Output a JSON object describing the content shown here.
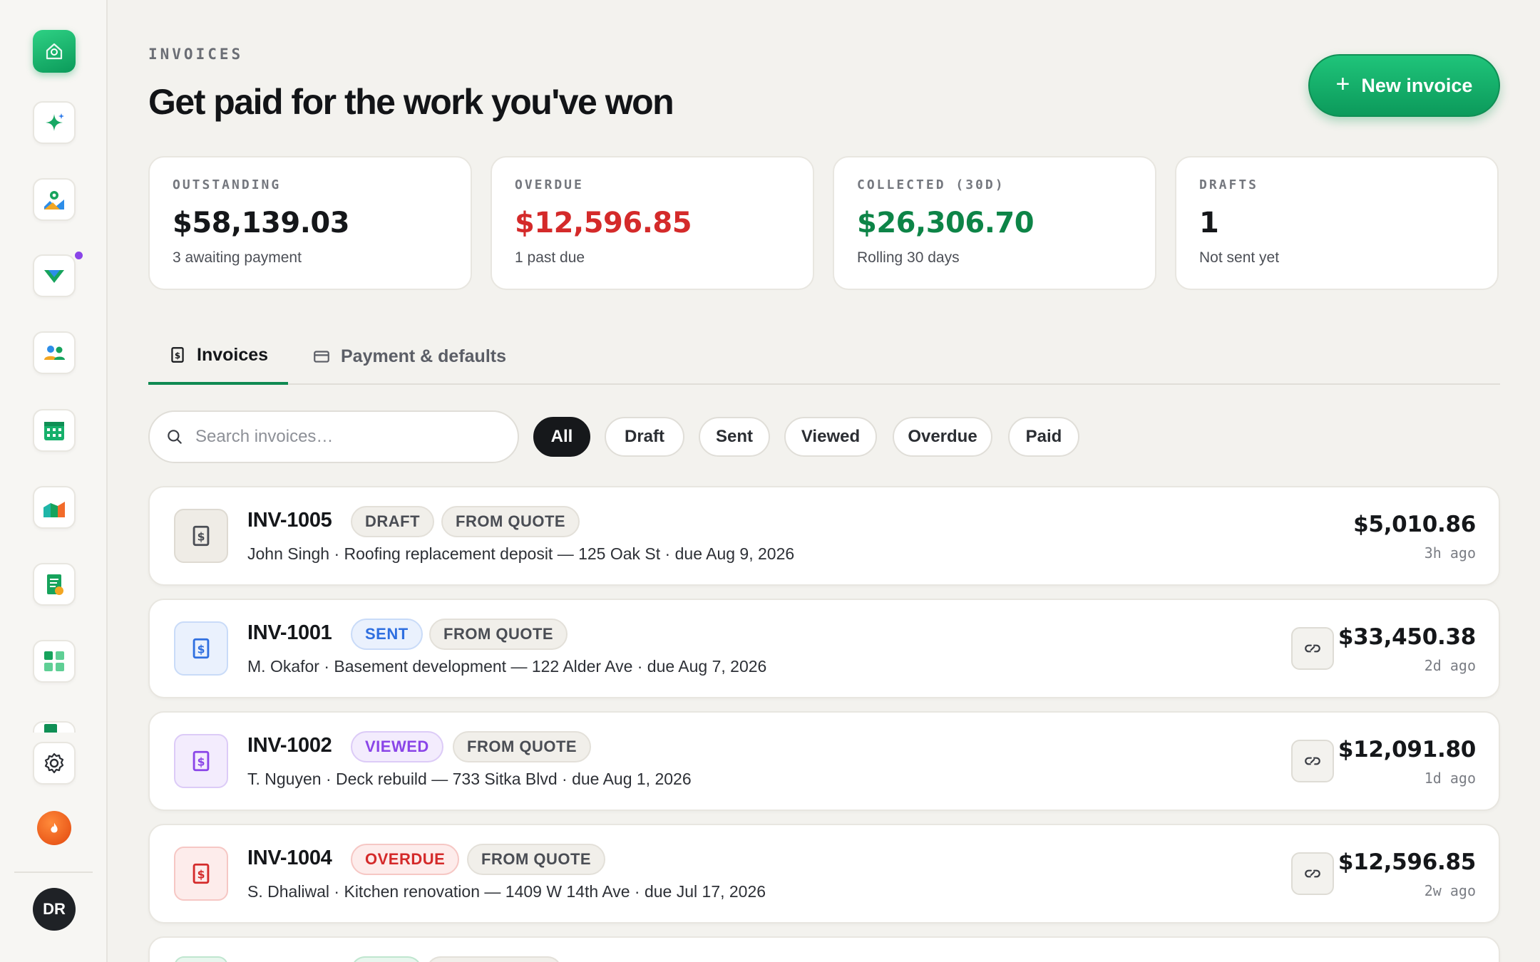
{
  "header": {
    "eyebrow": "INVOICES",
    "title": "Get paid for the work you've won",
    "new_button": "New invoice"
  },
  "stats": [
    {
      "label": "OUTSTANDING",
      "value": "$58,139.03",
      "sub": "3 awaiting payment",
      "color": "#15171a"
    },
    {
      "label": "OVERDUE",
      "value": "$12,596.85",
      "sub": "1 past due",
      "color": "#d42a2a"
    },
    {
      "label": "COLLECTED (30D)",
      "value": "$26,306.70",
      "sub": "Rolling 30 days",
      "color": "#0d8447"
    },
    {
      "label": "DRAFTS",
      "value": "1",
      "sub": "Not sent yet",
      "color": "#15171a"
    }
  ],
  "tabs": [
    {
      "label": "Invoices",
      "active": true
    },
    {
      "label": "Payment & defaults",
      "active": false
    }
  ],
  "search": {
    "placeholder": "Search invoices…",
    "value": ""
  },
  "filters": [
    "All",
    "Draft",
    "Sent",
    "Viewed",
    "Overdue",
    "Paid"
  ],
  "active_filter": "All",
  "invoices": [
    {
      "id": "INV-1005",
      "status": "DRAFT",
      "source": "FROM QUOTE",
      "description": "John Singh · Roofing replacement deposit — 125 Oak St · due Aug 9, 2026",
      "amount": "$5,010.86",
      "time": "3h ago"
    },
    {
      "id": "INV-1001",
      "status": "SENT",
      "source": "FROM QUOTE",
      "description": "M. Okafor · Basement development — 122 Alder Ave · due Aug 7, 2026",
      "amount": "$33,450.38",
      "time": "2d ago"
    },
    {
      "id": "INV-1002",
      "status": "VIEWED",
      "source": "FROM QUOTE",
      "description": "T. Nguyen · Deck rebuild — 733 Sitka Blvd · due Aug 1, 2026",
      "amount": "$12,091.80",
      "time": "1d ago"
    },
    {
      "id": "INV-1004",
      "status": "OVERDUE",
      "source": "FROM QUOTE",
      "description": "S. Dhaliwal · Kitchen renovation — 1409 W 14th Ave · due Jul 17, 2026",
      "amount": "$12,596.85",
      "time": "2w ago"
    }
  ],
  "user": {
    "initials": "DR"
  },
  "sidebar_icons": [
    "home-icon",
    "sparkle-icon",
    "map-icon",
    "leads-icon",
    "customers-icon",
    "calendar-icon",
    "reports-icon",
    "invoice-icon",
    "apps-icon",
    "settings-icon",
    "streak-icon"
  ]
}
